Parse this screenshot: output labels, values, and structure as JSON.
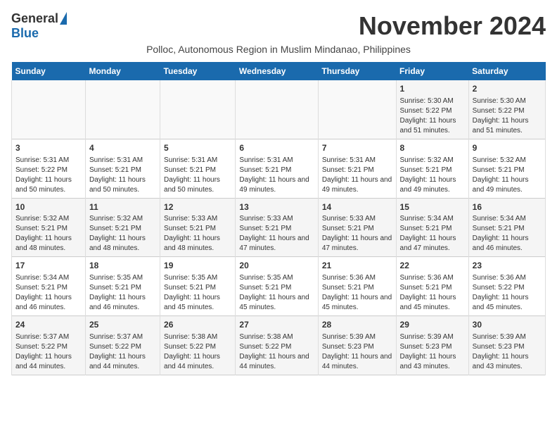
{
  "header": {
    "logo_general": "General",
    "logo_blue": "Blue",
    "month": "November 2024",
    "subtitle": "Polloc, Autonomous Region in Muslim Mindanao, Philippines"
  },
  "columns": [
    "Sunday",
    "Monday",
    "Tuesday",
    "Wednesday",
    "Thursday",
    "Friday",
    "Saturday"
  ],
  "weeks": [
    {
      "days": [
        {
          "num": "",
          "info": ""
        },
        {
          "num": "",
          "info": ""
        },
        {
          "num": "",
          "info": ""
        },
        {
          "num": "",
          "info": ""
        },
        {
          "num": "",
          "info": ""
        },
        {
          "num": "1",
          "info": "Sunrise: 5:30 AM\nSunset: 5:22 PM\nDaylight: 11 hours and 51 minutes."
        },
        {
          "num": "2",
          "info": "Sunrise: 5:30 AM\nSunset: 5:22 PM\nDaylight: 11 hours and 51 minutes."
        }
      ]
    },
    {
      "days": [
        {
          "num": "3",
          "info": "Sunrise: 5:31 AM\nSunset: 5:22 PM\nDaylight: 11 hours and 50 minutes."
        },
        {
          "num": "4",
          "info": "Sunrise: 5:31 AM\nSunset: 5:21 PM\nDaylight: 11 hours and 50 minutes."
        },
        {
          "num": "5",
          "info": "Sunrise: 5:31 AM\nSunset: 5:21 PM\nDaylight: 11 hours and 50 minutes."
        },
        {
          "num": "6",
          "info": "Sunrise: 5:31 AM\nSunset: 5:21 PM\nDaylight: 11 hours and 49 minutes."
        },
        {
          "num": "7",
          "info": "Sunrise: 5:31 AM\nSunset: 5:21 PM\nDaylight: 11 hours and 49 minutes."
        },
        {
          "num": "8",
          "info": "Sunrise: 5:32 AM\nSunset: 5:21 PM\nDaylight: 11 hours and 49 minutes."
        },
        {
          "num": "9",
          "info": "Sunrise: 5:32 AM\nSunset: 5:21 PM\nDaylight: 11 hours and 49 minutes."
        }
      ]
    },
    {
      "days": [
        {
          "num": "10",
          "info": "Sunrise: 5:32 AM\nSunset: 5:21 PM\nDaylight: 11 hours and 48 minutes."
        },
        {
          "num": "11",
          "info": "Sunrise: 5:32 AM\nSunset: 5:21 PM\nDaylight: 11 hours and 48 minutes."
        },
        {
          "num": "12",
          "info": "Sunrise: 5:33 AM\nSunset: 5:21 PM\nDaylight: 11 hours and 48 minutes."
        },
        {
          "num": "13",
          "info": "Sunrise: 5:33 AM\nSunset: 5:21 PM\nDaylight: 11 hours and 47 minutes."
        },
        {
          "num": "14",
          "info": "Sunrise: 5:33 AM\nSunset: 5:21 PM\nDaylight: 11 hours and 47 minutes."
        },
        {
          "num": "15",
          "info": "Sunrise: 5:34 AM\nSunset: 5:21 PM\nDaylight: 11 hours and 47 minutes."
        },
        {
          "num": "16",
          "info": "Sunrise: 5:34 AM\nSunset: 5:21 PM\nDaylight: 11 hours and 46 minutes."
        }
      ]
    },
    {
      "days": [
        {
          "num": "17",
          "info": "Sunrise: 5:34 AM\nSunset: 5:21 PM\nDaylight: 11 hours and 46 minutes."
        },
        {
          "num": "18",
          "info": "Sunrise: 5:35 AM\nSunset: 5:21 PM\nDaylight: 11 hours and 46 minutes."
        },
        {
          "num": "19",
          "info": "Sunrise: 5:35 AM\nSunset: 5:21 PM\nDaylight: 11 hours and 45 minutes."
        },
        {
          "num": "20",
          "info": "Sunrise: 5:35 AM\nSunset: 5:21 PM\nDaylight: 11 hours and 45 minutes."
        },
        {
          "num": "21",
          "info": "Sunrise: 5:36 AM\nSunset: 5:21 PM\nDaylight: 11 hours and 45 minutes."
        },
        {
          "num": "22",
          "info": "Sunrise: 5:36 AM\nSunset: 5:21 PM\nDaylight: 11 hours and 45 minutes."
        },
        {
          "num": "23",
          "info": "Sunrise: 5:36 AM\nSunset: 5:22 PM\nDaylight: 11 hours and 45 minutes."
        }
      ]
    },
    {
      "days": [
        {
          "num": "24",
          "info": "Sunrise: 5:37 AM\nSunset: 5:22 PM\nDaylight: 11 hours and 44 minutes."
        },
        {
          "num": "25",
          "info": "Sunrise: 5:37 AM\nSunset: 5:22 PM\nDaylight: 11 hours and 44 minutes."
        },
        {
          "num": "26",
          "info": "Sunrise: 5:38 AM\nSunset: 5:22 PM\nDaylight: 11 hours and 44 minutes."
        },
        {
          "num": "27",
          "info": "Sunrise: 5:38 AM\nSunset: 5:22 PM\nDaylight: 11 hours and 44 minutes."
        },
        {
          "num": "28",
          "info": "Sunrise: 5:39 AM\nSunset: 5:23 PM\nDaylight: 11 hours and 44 minutes."
        },
        {
          "num": "29",
          "info": "Sunrise: 5:39 AM\nSunset: 5:23 PM\nDaylight: 11 hours and 43 minutes."
        },
        {
          "num": "30",
          "info": "Sunrise: 5:39 AM\nSunset: 5:23 PM\nDaylight: 11 hours and 43 minutes."
        }
      ]
    }
  ]
}
